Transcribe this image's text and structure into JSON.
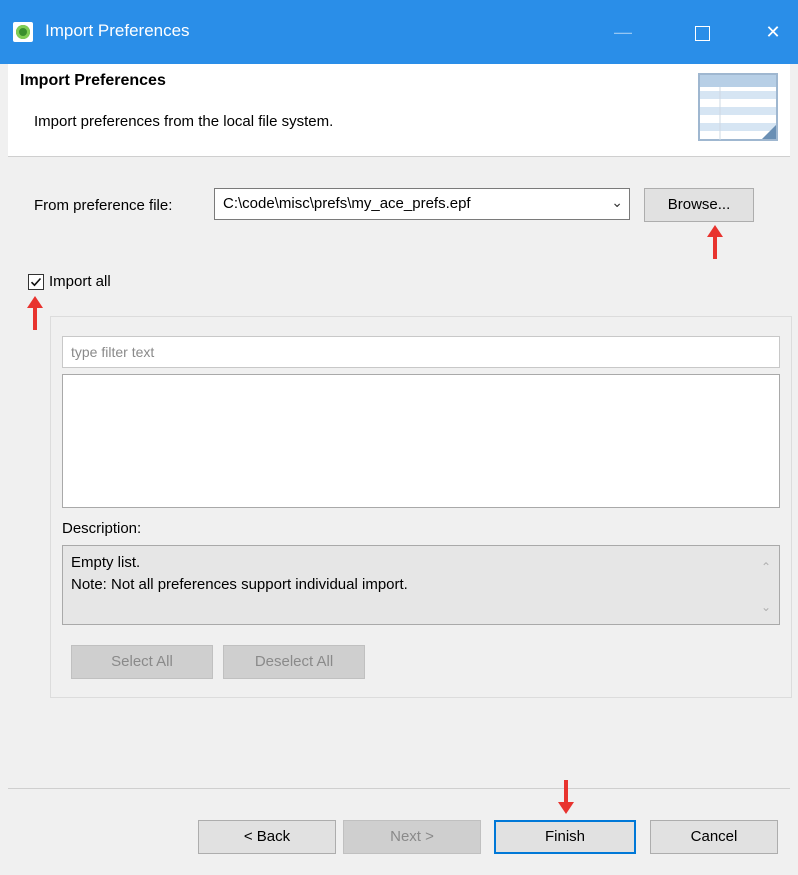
{
  "window": {
    "title": "Import Preferences",
    "controls": [
      "minimize-icon",
      "maximize-icon",
      "close-icon"
    ],
    "close_glyph": "✕"
  },
  "header": {
    "title": "Import Preferences",
    "description": "Import preferences from the local file system."
  },
  "form": {
    "from_label": "From preference file:",
    "file_value": "C:\\code\\misc\\prefs\\my_ace_prefs.epf",
    "browse_label": "Browse...",
    "import_all_label": "Import all",
    "import_all_checked": true
  },
  "tree": {
    "filter_placeholder": "type filter text",
    "description_label": "Description:",
    "description_lines": [
      "Empty list.",
      "Note: Not all preferences support individual import."
    ],
    "select_all_label": "Select All",
    "deselect_all_label": "Deselect All"
  },
  "footer": {
    "back_label": "< Back",
    "next_label": "Next >",
    "finish_label": "Finish",
    "cancel_label": "Cancel"
  },
  "colors": {
    "titlebar": "#2a8ee8",
    "annotation_arrow": "#e8332e",
    "default_button_border": "#0078d7"
  }
}
